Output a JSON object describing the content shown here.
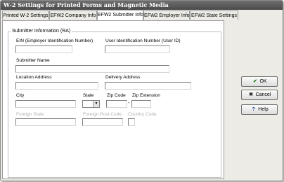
{
  "window": {
    "title": "W-2 Settings for Printed Forms and Magnetic Media"
  },
  "tabs": [
    {
      "label": "Printed W-2 Settings"
    },
    {
      "label": "EFW2 Company Info"
    },
    {
      "label": "EFW2 Submitter Info"
    },
    {
      "label": "EFW2 Employer Info"
    },
    {
      "label": "EFW2 State Settings"
    }
  ],
  "active_tab": "EFW2 Submitter Info",
  "form": {
    "group_title": "Submitter Information (RA)",
    "ein_label": "EIN (Employer Identification Number)",
    "ein_value": "",
    "user_id_label": "User Identification Number (User ID)",
    "user_id_value": "",
    "submitter_name_label": "Submitter Name",
    "submitter_name_value": "",
    "location_address_label": "Location Address",
    "location_address_value": "",
    "delivery_address_label": "Delivery Address",
    "delivery_address_value": "",
    "city_label": "City",
    "city_value": "",
    "state_label": "State",
    "state_value": "",
    "zip_code_label": "Zip Code",
    "zip_code_value": "",
    "zip_ext_label": "Zip Extension",
    "zip_ext_value": "",
    "zip_separator": "-",
    "foreign_state_label": "Foreign State",
    "foreign_state_value": "",
    "foreign_post_code_label": "Foreign Post Code",
    "foreign_post_code_value": "",
    "country_code_label": "Country Code",
    "country_code_value": ""
  },
  "buttons": {
    "ok": {
      "label": "OK",
      "icon": "check-icon"
    },
    "cancel": {
      "label": "Cancel",
      "icon": "x-icon"
    },
    "help": {
      "label": "Help",
      "icon": "question-icon"
    }
  },
  "colors": {
    "title_bar": "#5a5a5a",
    "title_text": "#ffffff",
    "disabled_text": "#b0b0b0"
  }
}
